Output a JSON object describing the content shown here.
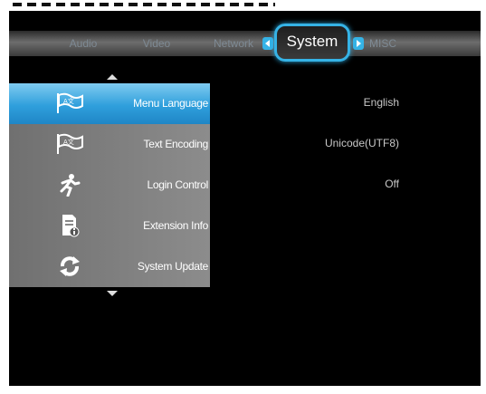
{
  "tabs": {
    "audio": "Audio",
    "video": "Video",
    "network": "Network",
    "system": "System",
    "misc": "MISC"
  },
  "menu": {
    "items": [
      {
        "label": "Menu Language",
        "value": "English",
        "icon": "flag-icon"
      },
      {
        "label": "Text Encoding",
        "value": "Unicode(UTF8)",
        "icon": "flag-icon"
      },
      {
        "label": "Login Control",
        "value": "Off",
        "icon": "running-man-icon"
      },
      {
        "label": "Extension Info",
        "icon": "document-info-icon"
      },
      {
        "label": "System Update",
        "icon": "refresh-icon"
      }
    ],
    "selected_index": 0
  },
  "colors": {
    "accent": "#35b3e6",
    "selected_row": "#2f9fdc",
    "panel": "#808080",
    "background": "#000000"
  }
}
